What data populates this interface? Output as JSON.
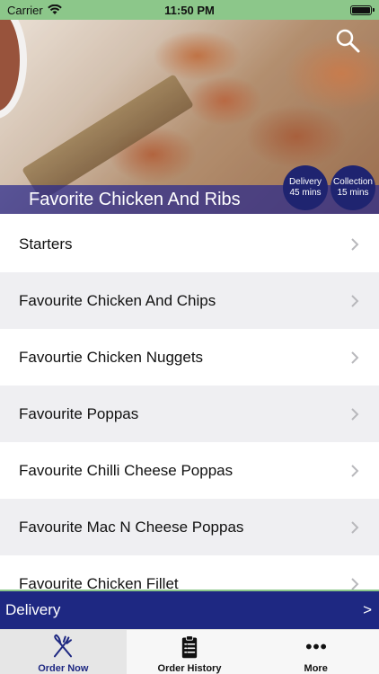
{
  "status_bar": {
    "carrier": "Carrier",
    "time": "11:50 PM"
  },
  "hero": {
    "title": "Favorite Chicken And Ribs",
    "delivery_label": "Delivery",
    "delivery_time": "45 mins",
    "collection_label": "Collection",
    "collection_time": "15 mins"
  },
  "menu": {
    "items": [
      {
        "label": "Starters"
      },
      {
        "label": "Favourite Chicken And Chips"
      },
      {
        "label": "Favourtie Chicken Nuggets"
      },
      {
        "label": "Favourite Poppas"
      },
      {
        "label": "Favourite Chilli Cheese Poppas"
      },
      {
        "label": "Favourite Mac N Cheese Poppas"
      },
      {
        "label": "Favourite Chicken Fillet"
      }
    ]
  },
  "delivery_bar": {
    "label": "Delivery",
    "arrow": ">"
  },
  "tabs": [
    {
      "label": "Order Now",
      "icon": "fork-knife-icon",
      "active": true
    },
    {
      "label": "Order History",
      "icon": "clipboard-icon",
      "active": false
    },
    {
      "label": "More",
      "icon": "more-dots-icon",
      "active": false
    }
  ],
  "colors": {
    "status_bar": "#8cc78a",
    "brand_navy": "#1e2882",
    "badge": "#1f2470",
    "row_alt": "#efeff2"
  }
}
